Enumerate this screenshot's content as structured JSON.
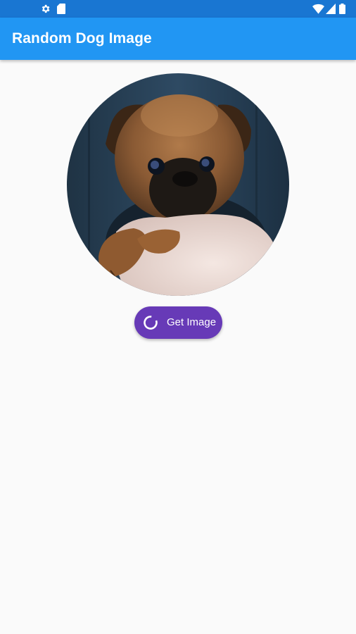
{
  "status_bar": {
    "icons": [
      "settings-icon",
      "sd-card-icon",
      "wifi-icon",
      "signal-icon",
      "battery-icon"
    ],
    "background": "#1976d2"
  },
  "app_bar": {
    "title": "Random Dog Image",
    "background": "#2196f3"
  },
  "dog_image": {
    "subject": "puppy",
    "shape": "circle"
  },
  "get_image_button": {
    "label": "Get Image",
    "icon": "loading-spinner-icon",
    "background": "#673ab7"
  }
}
